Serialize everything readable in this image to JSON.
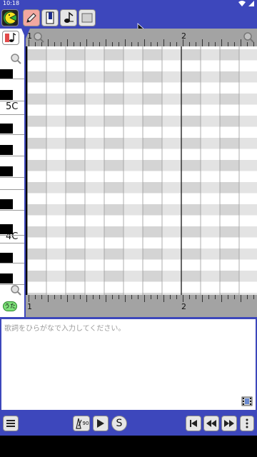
{
  "status": {
    "time": "10:18"
  },
  "ruler": {
    "top_bar_1": "1",
    "top_bar_2": "2",
    "bottom_bar_1": "1",
    "bottom_bar_2": "2"
  },
  "keyboard": {
    "label_5c": "5C",
    "label_4c": "4C"
  },
  "lyrics": {
    "placeholder": "歌詞をひらがなで入力してください。",
    "uta_label": "うた"
  },
  "transport": {
    "tempo": "90",
    "s_label": "S"
  },
  "colors": {
    "accent": "#3d47bc",
    "grid_gray": "#d4d4d4",
    "ruler_gray": "#a3a3a3"
  },
  "icons": [
    "pacman-icon",
    "pencil-icon",
    "piano-icon",
    "note-icon",
    "rectangle-icon",
    "zoom-icon",
    "menu-icon",
    "metronome-icon",
    "play-icon",
    "skip-start-icon",
    "rewind-icon",
    "fast-forward-icon",
    "more-vert-icon",
    "film-icon"
  ]
}
